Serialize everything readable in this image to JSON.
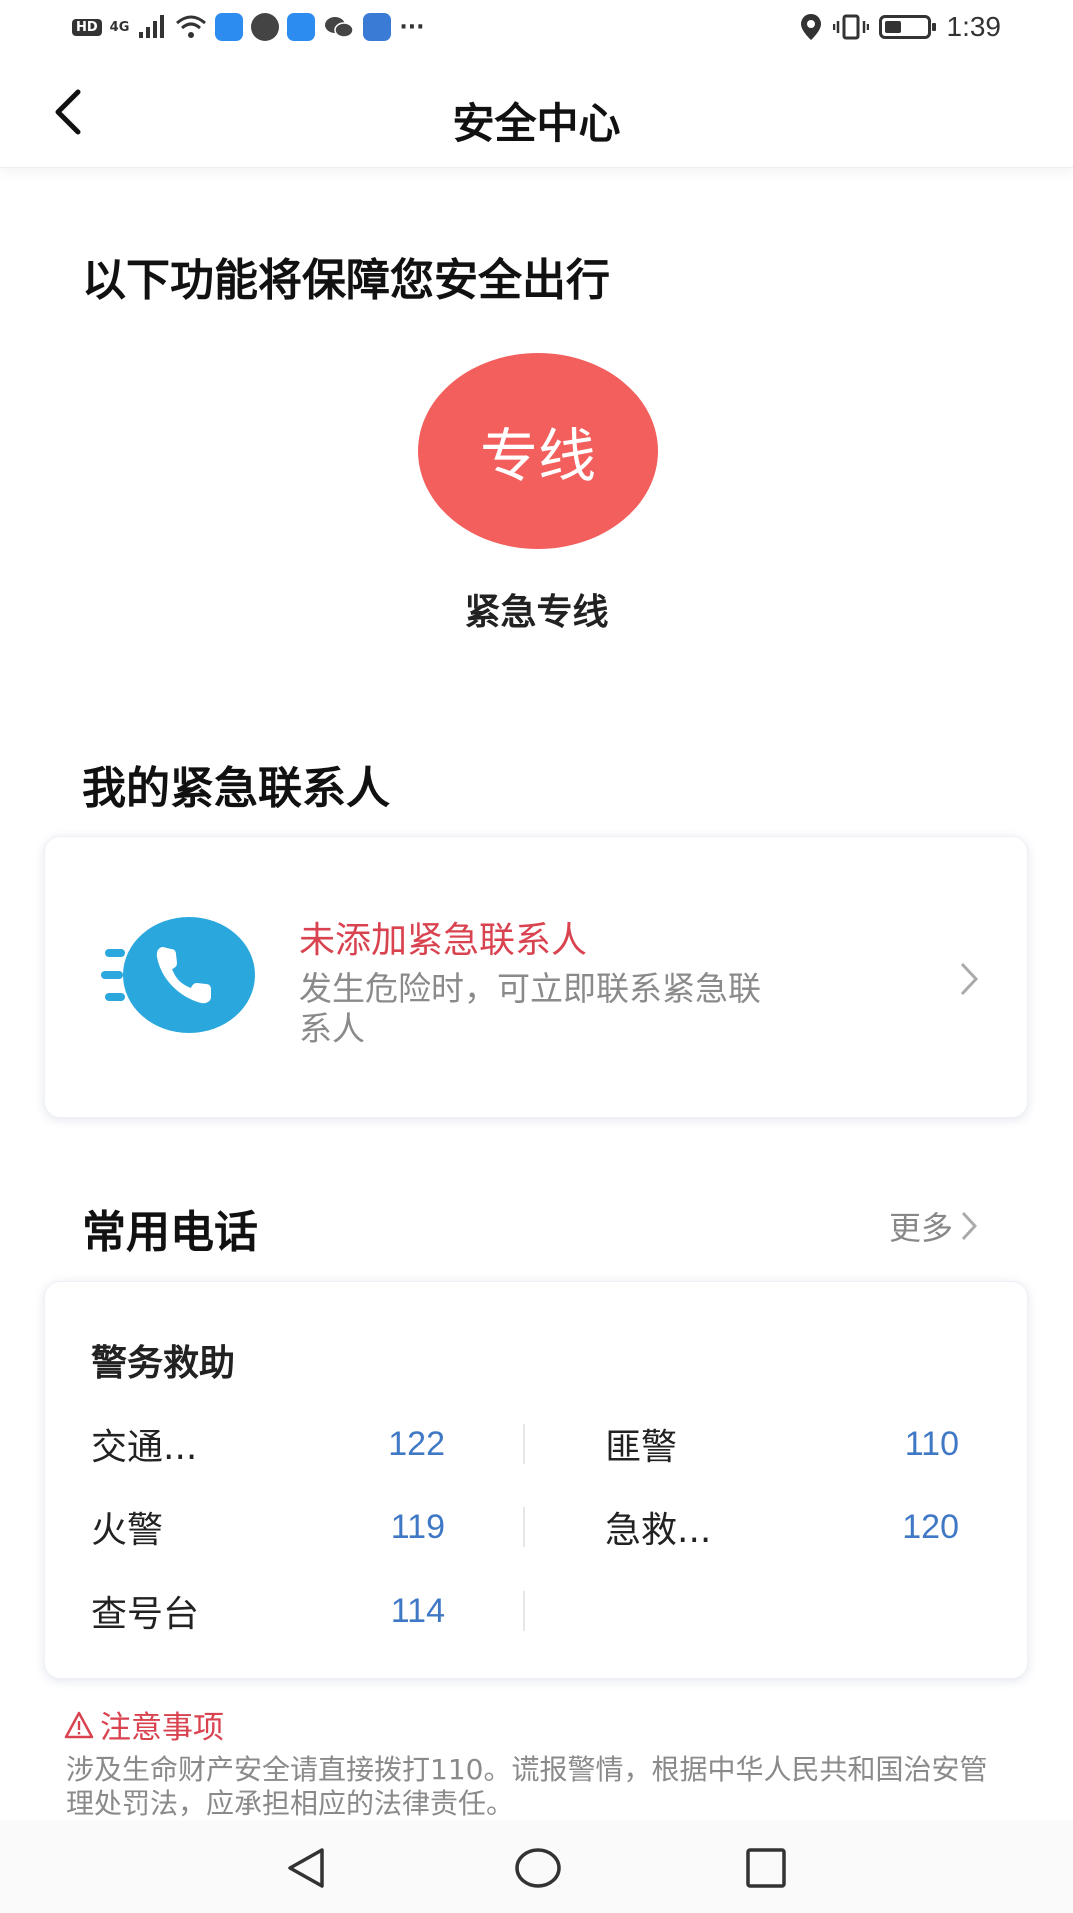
{
  "status_bar": {
    "network": "4G",
    "hd": "HD",
    "more": "···",
    "time": "1:39",
    "icons": [
      "hd-icon",
      "signal-icon",
      "wifi-icon",
      "weather-icon",
      "message-icon",
      "sim-icon",
      "wechat-icon",
      "cloud-icon",
      "location-icon",
      "vibrate-icon",
      "battery-icon"
    ]
  },
  "header": {
    "title": "安全中心"
  },
  "intro": {
    "heading": "以下功能将保障您安全出行",
    "hotline_button": "专线",
    "hotline_label": "紧急专线"
  },
  "contacts": {
    "heading": "我的紧急联系人",
    "title": "未添加紧急联系人",
    "description": "发生危险时，可立即联系紧急联系人"
  },
  "phones": {
    "heading": "常用电话",
    "more": "更多",
    "subheading": "警务救助",
    "items": [
      {
        "name": "交通...",
        "number": "122"
      },
      {
        "name": "匪警",
        "number": "110"
      },
      {
        "name": "火警",
        "number": "119"
      },
      {
        "name": "急救...",
        "number": "120"
      },
      {
        "name": "查号台",
        "number": "114"
      }
    ]
  },
  "notice": {
    "title": "注意事项",
    "text": "涉及生命财产安全请直接拨打110。谎报警情，根据中华人民共和国治安管理处罚法，应承担相应的法律责任。"
  },
  "colors": {
    "hotline": "#f25f5c",
    "contact_title": "#d9434f",
    "phone_number": "#3f78c4",
    "phone_icon": "#2aa8de"
  }
}
